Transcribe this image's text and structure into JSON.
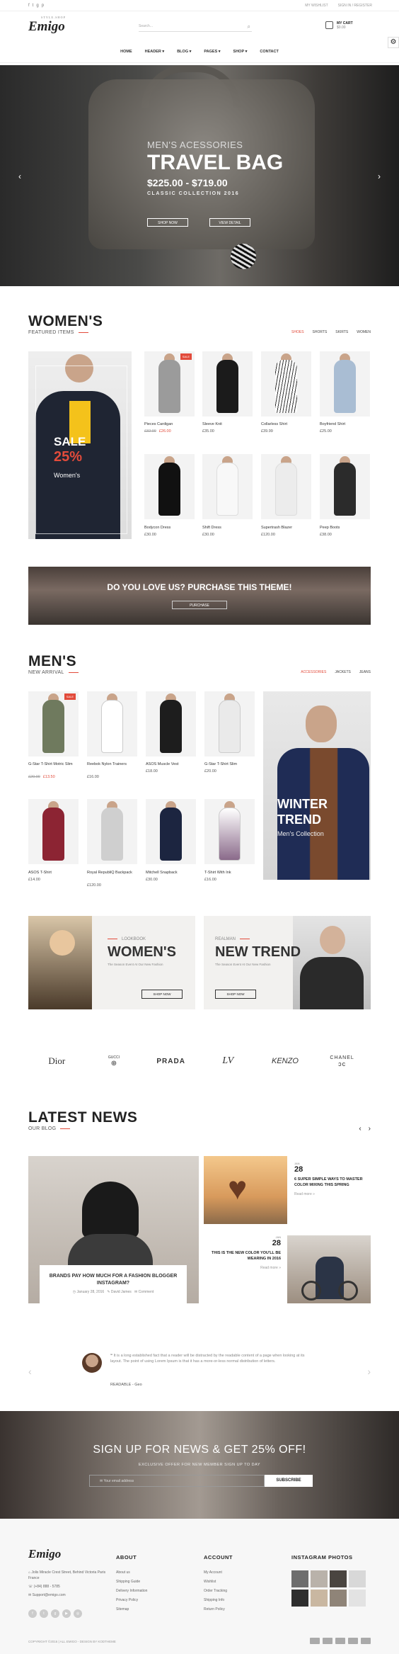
{
  "topbar": {
    "social_icons": [
      "facebook-icon",
      "twitter-icon",
      "google-plus-icon",
      "pinterest-icon"
    ],
    "wishlist": "MY WISHLIST",
    "signin": "SIGN IN / REGISTER"
  },
  "header": {
    "logo": "Emigo",
    "logo_tag": "STYLE.SHOP",
    "search_placeholder": "Search...",
    "cart_title": "MY CART",
    "cart_amount": "$0.00"
  },
  "nav": [
    "HOME",
    "HEADER",
    "BLOG",
    "PAGES",
    "SHOP",
    "CONTACT"
  ],
  "hero": {
    "subtitle": "MEN'S ACESSORIES",
    "title": "TRAVEL BAG",
    "price": "$225.00 - $719.00",
    "collection": "CLASSIC COLLECTION 2016",
    "btn_shop": "SHOP NOW",
    "btn_view": "VIEW DETAIL"
  },
  "women": {
    "title": "WOMEN'S",
    "subtitle": "FEATURED ITEMS",
    "tabs": [
      "SHOES",
      "SHORTS",
      "SKIRTS",
      "WOMEN"
    ],
    "banner_sale": "SALE",
    "banner_pct": "25%",
    "banner_label": "Women's",
    "products": [
      {
        "name": "Pieces Cardigan",
        "old": "£32.00",
        "price": "£26.00",
        "sale": "SALE"
      },
      {
        "name": "Sleeve Knit",
        "price": "£35.00"
      },
      {
        "name": "Collarless Shirt",
        "price": "£39.99"
      },
      {
        "name": "Boyfriend Shirt",
        "price": "£25.00"
      },
      {
        "name": "Bodycon Dress",
        "price": "£30.00"
      },
      {
        "name": "Shift Dress",
        "price": "£30.00"
      },
      {
        "name": "Supertrash Blazer",
        "price": "£120.00"
      },
      {
        "name": "Peep Boots",
        "price": "£38.00"
      }
    ]
  },
  "promo_banner": {
    "title": "DO YOU LOVE US? PURCHASE THIS THEME!",
    "button": "PURCHASE"
  },
  "men": {
    "title": "MEN'S",
    "subtitle": "NEW ARRIVAL",
    "tabs": [
      "ACCESSORIES",
      "JACKETS",
      "JEANS"
    ],
    "banner_title_1": "WINTER",
    "banner_title_2": "TREND",
    "banner_label": "Men's Collection",
    "products": [
      {
        "name": "G-Star T-Shirt Motric Slim",
        "old": "£20.00",
        "price": "£13.50",
        "sale": "SALE"
      },
      {
        "name": "Reebok Nylon Trainers",
        "price": "£16.00"
      },
      {
        "name": "ASOS Muscle Vest",
        "price": "£18.00"
      },
      {
        "name": "G-Star T-Shirt Slim",
        "price": "£20.00"
      },
      {
        "name": "ASOS T-Shirt",
        "price": "£14.00"
      },
      {
        "name": "Royal RepubliQ Backpack",
        "price": "£120.00"
      },
      {
        "name": "Mitchell Snapback",
        "price": "£30.00"
      },
      {
        "name": "T-Shirt With Ink",
        "price": "£16.00"
      }
    ]
  },
  "promos": [
    {
      "kicker": "LOOKBOOK",
      "title": "WOMEN'S",
      "text": "The Season Event At Our New Fashion",
      "button": "SHOP NOW"
    },
    {
      "kicker": "REALMAN",
      "title": "NEW TREND",
      "text": "The Season Event At Our New Fashion",
      "button": "SHOP NOW"
    }
  ],
  "brands": [
    "Dior",
    "GUCCI",
    "PRADA",
    "LV",
    "KENZO",
    "CHANEL"
  ],
  "news": {
    "title": "LATEST NEWS",
    "subtitle": "OUR BLOG",
    "main": {
      "title": "BRANDS PAY HOW MUCH FOR A FASHION BLOGGER INSTAGRAM?",
      "date": "January 28, 2016",
      "author": "David James",
      "comments": "Comment"
    },
    "items": [
      {
        "day": "28",
        "month": "JAN",
        "title": "6 SUPER SIMPLE WAYS TO MASTER COLOR MIXING THIS SPRING",
        "more": "Read more »"
      },
      {
        "day": "28",
        "month": "JAN",
        "title": "THIS IS THE NEW COLOR YOU'LL BE WEARING IN 2016",
        "more": "Read more »"
      }
    ]
  },
  "testimonial": {
    "quote": "It is a long established fact that a reader will be distracted by the readable content of a page when looking at its layout. The point of using Lorem Ipsum is that it has a more-or-less normal distribution of letters.",
    "name": "READABLE - Geo"
  },
  "newsletter": {
    "title": "SIGN UP FOR NEWS & GET 25% OFF!",
    "text": "EXCLUSIVE OFFER FOR NEW MEMBER SIGN UP TO DAY",
    "placeholder": "Your email address",
    "button": "SUBSCRIBE"
  },
  "footer": {
    "logo": "Emigo",
    "address": "Jolis Miracle Crest Street, Behind Victoria Paris France",
    "phone": "(+84) 888 - 5785",
    "email": "Support@emigo.com",
    "about_title": "ABOUT",
    "about_links": [
      "About us",
      "Shipping Guide",
      "Delivery Information",
      "Privacy Policy",
      "Sitemap"
    ],
    "account_title": "ACCOUNT",
    "account_links": [
      "My Account",
      "Wishlist",
      "Order Tracking",
      "Shipping Info",
      "Return Policy"
    ],
    "insta_title": "INSTAGRAM PHOTOS",
    "copyright": "COPYRIGHT ©2016 | ALL EMIGO - DESIGN BY KODTHEME"
  },
  "colors": {
    "accent": "#e24b3b"
  }
}
